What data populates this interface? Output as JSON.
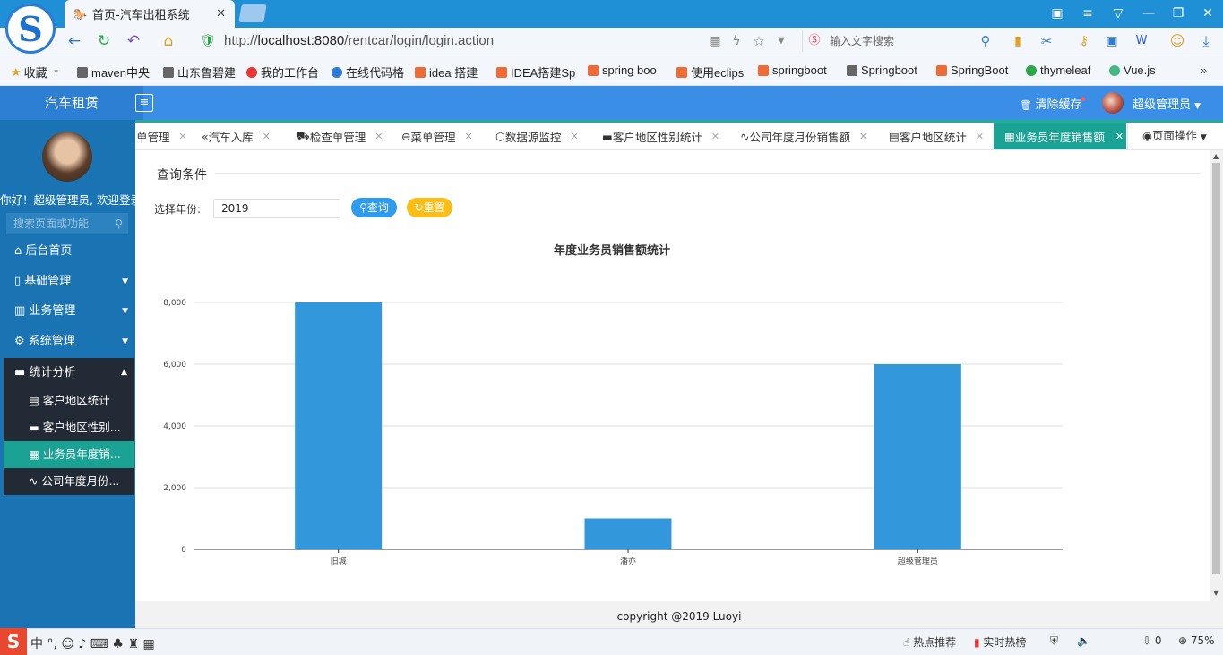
{
  "browser": {
    "tab_title": "首页-汽车出租系统",
    "url_prefix": "http://",
    "url_host": "localhost:8080",
    "url_path": "/rentcar/login/login.action",
    "search_placeholder": "输入文字搜索",
    "bookmarks": [
      "收藏",
      "maven中央",
      "山东鲁碧建",
      "我的工作台",
      "在线代码格",
      "idea 搭建",
      "IDEA搭建Sp",
      "spring boo",
      "使用eclips",
      "springboot",
      "Springboot",
      "SpringBoot",
      "thymeleaf",
      "Vue.js"
    ]
  },
  "app": {
    "brand": "汽车租赁",
    "clear_cache": "清除缓存",
    "user": "超级管理员",
    "welcome": "你好！超级管理员, 欢迎登录",
    "sidebar_search_placeholder": "搜索页面或功能",
    "menu": [
      "后台首页",
      "基础管理",
      "业务管理",
      "系统管理",
      "统计分析"
    ],
    "submenu": [
      "客户地区统计",
      "客户地区性别...",
      "业务员年度销...",
      "公司年度月份..."
    ],
    "tabs": [
      "单管理",
      "汽车入库",
      "检查单管理",
      "菜单管理",
      "数据源监控",
      "客户地区性别统计",
      "公司年度月份销售额",
      "客户地区统计"
    ],
    "active_tab": "业务员年度销售额",
    "page_ops": "页面操作"
  },
  "query": {
    "legend": "查询条件",
    "year_label": "选择年份:",
    "year_value": "2019",
    "query_btn": "查询",
    "reset_btn": "重置"
  },
  "chart_data": {
    "type": "bar",
    "title": "年度业务员销售额统计",
    "categories": [
      "旧城",
      "潘亦",
      "超级管理员"
    ],
    "values": [
      8000,
      1000,
      6000
    ],
    "ylim": [
      0,
      8000
    ],
    "yticks": [
      "0",
      "2,000",
      "4,000",
      "6,000",
      "8,000"
    ],
    "color": "#3398db",
    "grid": true
  },
  "footer": "copyright @2019 Luoyi",
  "taskbar": {
    "hot": "热点推荐",
    "live": "实时热榜",
    "zoom": "75%",
    "count": "0"
  }
}
